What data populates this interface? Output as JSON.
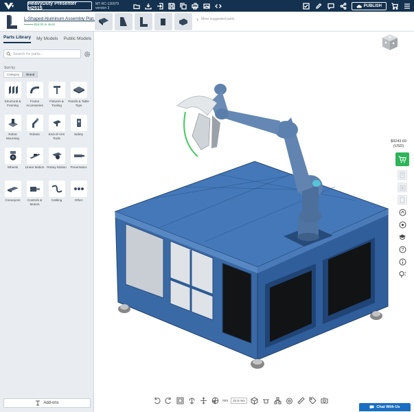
{
  "header": {
    "project_name": "HeavyDuty Presenter H2515",
    "project_id": "MT-RC-130979",
    "project_version": "version 3",
    "publish_label": "PUBLISH"
  },
  "suggested": {
    "part_title": "L-Shaped Aluminum Assembly Plat...",
    "part_subtitle": "━━━━━ $16.00 in stock",
    "more_label": "More suggested parts"
  },
  "sidebar": {
    "tabs": [
      {
        "label": "Parts Library",
        "active": true
      },
      {
        "label": "My Models",
        "active": false
      },
      {
        "label": "Public Models",
        "active": false
      }
    ],
    "search_placeholder": "Search for parts...",
    "sort_by_label": "Sort by",
    "sort_options": [
      "Category",
      "Brand"
    ],
    "categories": [
      {
        "label": "Structural & Framing",
        "icon": "structural-icon"
      },
      {
        "label": "Frame Accessories",
        "icon": "frame-accessory-icon"
      },
      {
        "label": "Fixtures & Tooling",
        "icon": "fixture-icon"
      },
      {
        "label": "Panels & Table Tops",
        "icon": "panel-icon"
      },
      {
        "label": "Robot Mounting",
        "icon": "robot-mount-icon"
      },
      {
        "label": "Robots",
        "icon": "robot-icon"
      },
      {
        "label": "End-of-Arm Tools",
        "icon": "eoat-icon"
      },
      {
        "label": "Safety",
        "icon": "safety-icon"
      },
      {
        "label": "Wheels",
        "icon": "wheel-icon"
      },
      {
        "label": "Linear Motion",
        "icon": "linear-icon"
      },
      {
        "label": "Rotary Motion",
        "icon": "rotary-icon"
      },
      {
        "label": "Pneumatics",
        "icon": "pneumatic-icon"
      },
      {
        "label": "Conveyors",
        "icon": "conveyor-icon"
      },
      {
        "label": "Controls & Motors",
        "icon": "controls-icon"
      },
      {
        "label": "Cabling",
        "icon": "cabling-icon"
      },
      {
        "label": "Other",
        "icon": "other-icon"
      }
    ],
    "addons_label": "Add-ons"
  },
  "viewport": {
    "price": "$9243.69",
    "currency": "(USD)",
    "unit_label": "mm",
    "step_value": "22.5 mm",
    "chat_label": "Chat With Us"
  },
  "colors": {
    "topbar": "#14324f",
    "frame_blue": "#3f6ea8",
    "robot_blue": "#5577a3",
    "cart_green": "#2eb459",
    "chat_blue": "#1a6fc2"
  }
}
